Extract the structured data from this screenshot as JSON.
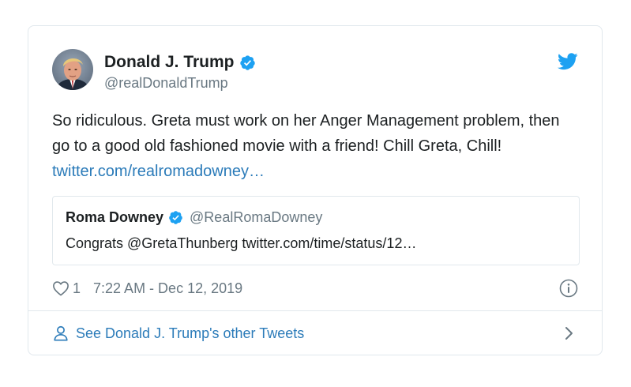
{
  "tweet": {
    "author_name": "Donald J. Trump",
    "author_handle": "@realDonaldTrump",
    "text": "So ridiculous. Greta must work on her Anger Management problem, then go to a good old fashioned movie with a friend! Chill Greta, Chill! ",
    "link_text": "twitter.com/realromadowney…",
    "like_count": "1",
    "timestamp": "7:22 AM - Dec 12, 2019"
  },
  "quoted": {
    "name": "Roma Downey",
    "handle": "@RealRomaDowney",
    "text": "Congrats @GretaThunberg twitter.com/time/status/12…"
  },
  "footer": {
    "label": "See Donald J. Trump's other Tweets"
  },
  "icons": {
    "verified": "verified-badge-icon",
    "brand": "twitter-bird-icon",
    "like": "heart-icon",
    "info": "info-icon",
    "profile": "person-icon",
    "chevron": "chevron-right-icon"
  },
  "colors": {
    "brand_blue": "#1da1f2",
    "link_blue": "#2b7bb9",
    "secondary_text": "#697882",
    "border": "#e1e8ed"
  }
}
